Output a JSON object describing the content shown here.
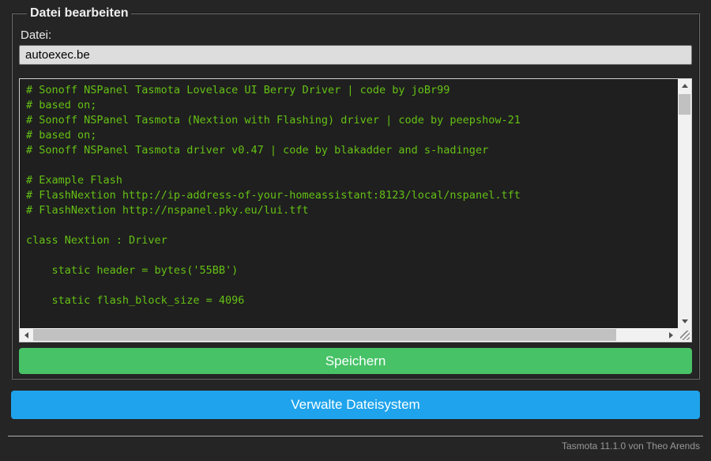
{
  "colors": {
    "page_bg": "#252525",
    "text": "#eaeaea",
    "input_bg": "#dddddd",
    "editor_bg": "#1f1f1f",
    "editor_text": "#65c115",
    "save_button": "#47c266",
    "manage_button": "#1fa3ec",
    "footer_text": "#999999",
    "scrollbar_track": "#f1f1f1",
    "scrollbar_thumb": "#c1c1c1"
  },
  "form": {
    "legend": "Datei bearbeiten",
    "file_label": "Datei:",
    "file_input_value": "autoexec.be",
    "save_button_label": "Speichern",
    "manage_button_label": "Verwalte Dateisystem"
  },
  "editor": {
    "lines": [
      "# Sonoff NSPanel Tasmota Lovelace UI Berry Driver | code by joBr99",
      "# based on;",
      "# Sonoff NSPanel Tasmota (Nextion with Flashing) driver | code by peepshow-21",
      "# based on;",
      "# Sonoff NSPanel Tasmota driver v0.47 | code by blakadder and s-hadinger",
      "",
      "# Example Flash",
      "# FlashNextion http://ip-address-of-your-homeassistant:8123/local/nspanel.tft",
      "# FlashNextion http://nspanel.pky.eu/lui.tft",
      "",
      "class Nextion : Driver",
      "",
      "    static header = bytes('55BB')",
      "",
      "    static flash_block_size = 4096"
    ]
  },
  "footer": {
    "text": "Tasmota 11.1.0 von Theo Arends"
  }
}
